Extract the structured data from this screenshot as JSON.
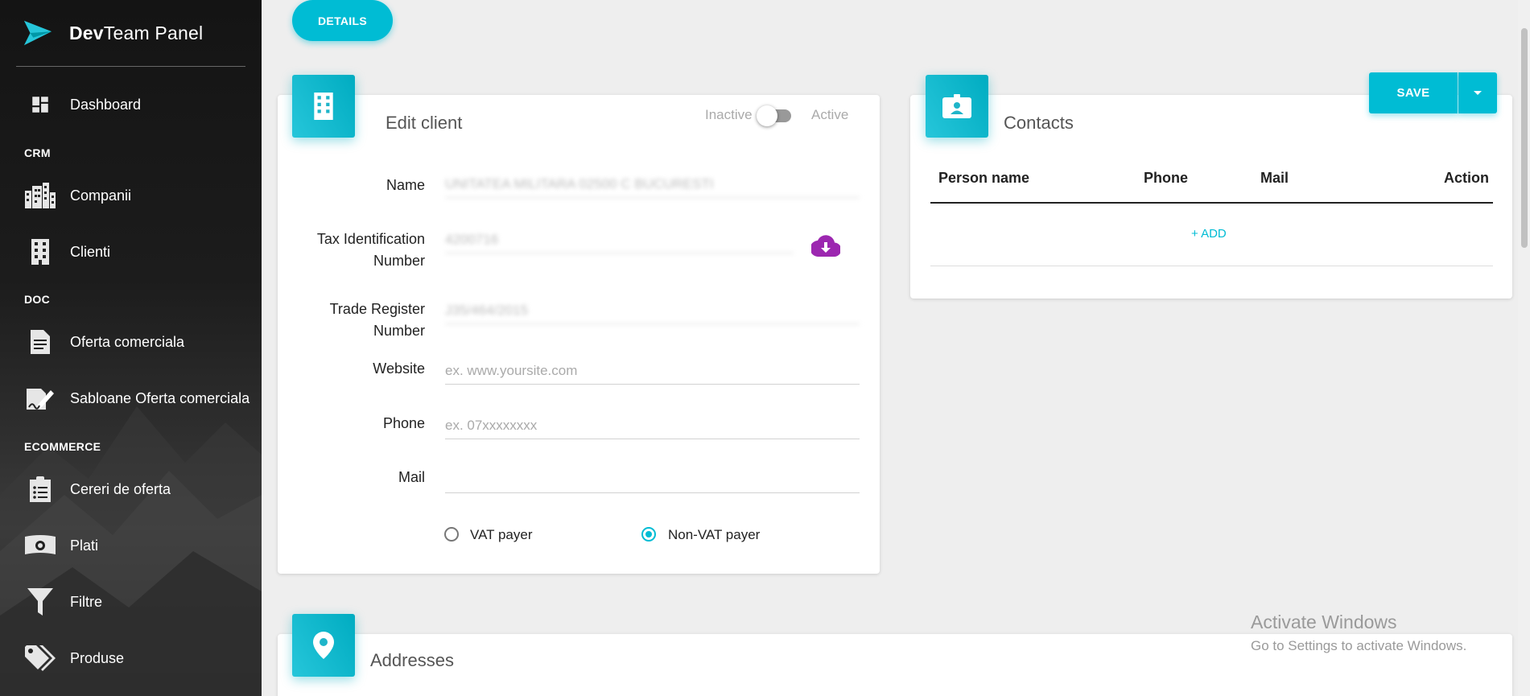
{
  "brand": {
    "bold": "Dev",
    "rest": "Team Panel"
  },
  "sidebar": {
    "items": [
      {
        "label": "Dashboard",
        "icon": "dashboard-icon"
      },
      {
        "label": "Companii",
        "icon": "city-icon"
      },
      {
        "label": "Clienti",
        "icon": "building-icon"
      },
      {
        "label": "Oferta comerciala",
        "icon": "document-icon"
      },
      {
        "label": "Sabloane Oferta comerciala",
        "icon": "signature-icon"
      },
      {
        "label": "Cereri de oferta",
        "icon": "clipboard-list-icon"
      },
      {
        "label": "Plati",
        "icon": "money-icon"
      },
      {
        "label": "Filtre",
        "icon": "filter-icon"
      },
      {
        "label": "Produse",
        "icon": "tags-icon"
      }
    ],
    "sections": {
      "crm": "CRM",
      "doc": "DOC",
      "ecommerce": "ECOMMERCE"
    }
  },
  "details_button": "DETAILS",
  "edit_client": {
    "title": "Edit client",
    "status": {
      "inactive": "Inactive",
      "active": "Active",
      "is_active": false
    },
    "fields": {
      "name": {
        "label": "Name",
        "value": "UNITATEA MILITARA 02500 C BUCURESTI"
      },
      "tax_id": {
        "label_line1": "Tax Identification",
        "label_line2": "Number",
        "value": "4200716"
      },
      "trade_register": {
        "label_line1": "Trade Register",
        "label_line2": "Number",
        "value": "J35/464/2015"
      },
      "website": {
        "label": "Website",
        "placeholder": "ex. www.yoursite.com"
      },
      "phone": {
        "label": "Phone",
        "placeholder": "ex. 07xxxxxxxx"
      },
      "mail": {
        "label": "Mail",
        "value": ""
      }
    },
    "vat": {
      "vat_payer": "VAT payer",
      "non_vat_payer": "Non-VAT payer",
      "selected": "non_vat_payer"
    }
  },
  "contacts": {
    "title": "Contacts",
    "save_label": "SAVE",
    "columns": [
      "Person name",
      "Phone",
      "Mail",
      "Action"
    ],
    "add_label": "+ ADD"
  },
  "addresses": {
    "title": "Addresses"
  },
  "windows_watermark": {
    "line1": "Activate Windows",
    "line2": "Go to Settings to activate Windows."
  },
  "colors": {
    "accent": "#00bcd4",
    "cloud": "#9c27b0",
    "sidebar": "#1c1c1c"
  }
}
